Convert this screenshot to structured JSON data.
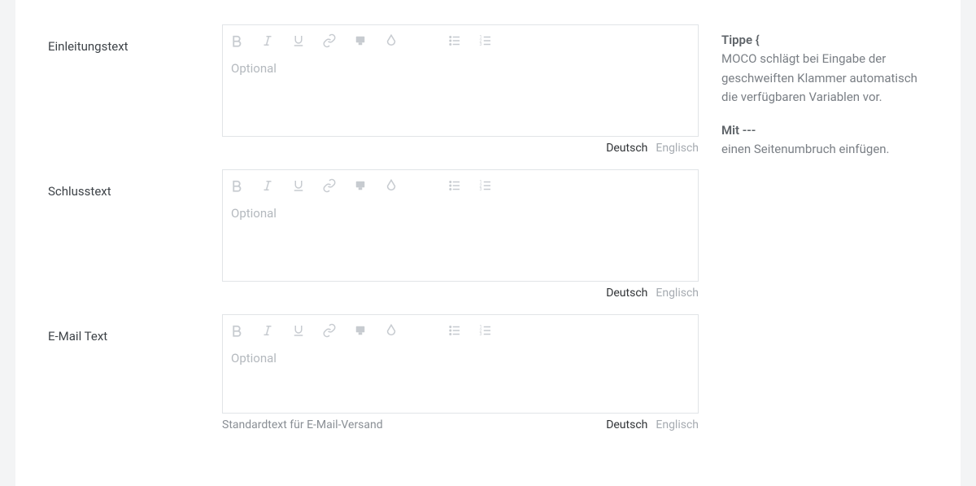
{
  "fields": {
    "intro": {
      "label": "Einleitungstext",
      "placeholder": "Optional",
      "note": ""
    },
    "closing": {
      "label": "Schlusstext",
      "placeholder": "Optional",
      "note": ""
    },
    "email": {
      "label": "E-Mail Text",
      "placeholder": "Optional",
      "note": "Standardtext für E-Mail-Versand"
    }
  },
  "lang_tabs": {
    "de": "Deutsch",
    "en": "Englisch"
  },
  "hints": {
    "brace_lead": "Tippe {",
    "brace_body": "MOCO schlägt bei Eingabe der geschweiften Klammer automatisch die verfügbaren Variablen vor.",
    "dash_lead": "Mit ---",
    "dash_body": "einen Seitenumbruch einfügen."
  },
  "toolbar_icons": [
    "bold",
    "italic",
    "underline",
    "link",
    "highlight",
    "color",
    "bullet-list",
    "ordered-list"
  ]
}
